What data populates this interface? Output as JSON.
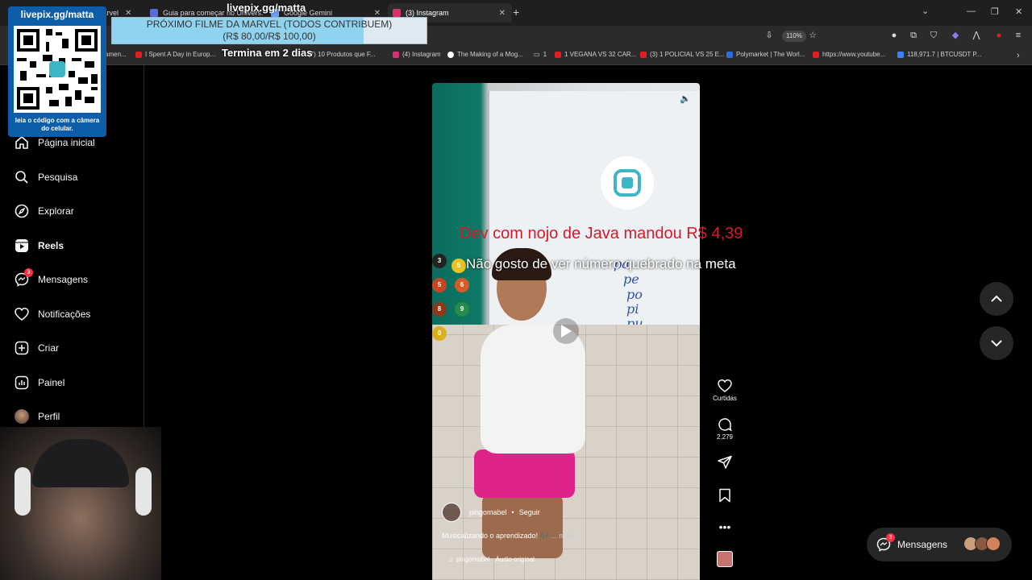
{
  "tabs": [
    {
      "label": "Marvel",
      "favicon_color": "#4a90d9"
    },
    {
      "label": "Guia para começar no Univers...",
      "favicon_color": "#5b6bd6"
    },
    {
      "label": "Google Gemini",
      "favicon_color": "#6aa0ff"
    },
    {
      "label": "(3) Instagram",
      "favicon_color": "#d6306f",
      "active": true
    }
  ],
  "toolbar": {
    "zoom": "110%"
  },
  "bookmarks": [
    {
      "label": "amen...",
      "color": "#4a90d9"
    },
    {
      "label": "I Spent A Day in Europ...",
      "color": "#e02020"
    },
    {
      "label": "(7) 10 Produtos que F...",
      "color": "#e02020"
    },
    {
      "label": "(4) Instagram",
      "color": "#d6306f"
    },
    {
      "label": "The Making of a Mog...",
      "color": "#ffffff"
    },
    {
      "label": "1",
      "color": "#cccccc"
    },
    {
      "label": "1 VEGANA VS 32 CAR...",
      "color": "#e02020"
    },
    {
      "label": "(3) 1 POLICIAL VS 25 E...",
      "color": "#e02020"
    },
    {
      "label": "Polymarket | The Worl...",
      "color": "#2d6cdf"
    },
    {
      "label": "https://www.youtube...",
      "color": "#e02020"
    },
    {
      "label": "118,971.7 | BTCUSDT P...",
      "color": "#3b82f6"
    }
  ],
  "sidebar": {
    "items": [
      {
        "label": "Página inicial",
        "icon": "home-icon"
      },
      {
        "label": "Pesquisa",
        "icon": "search-icon"
      },
      {
        "label": "Explorar",
        "icon": "compass-icon"
      },
      {
        "label": "Reels",
        "icon": "reels-icon",
        "active": true
      },
      {
        "label": "Mensagens",
        "icon": "messenger-icon",
        "badge": "3"
      },
      {
        "label": "Notificações",
        "icon": "heart-icon"
      },
      {
        "label": "Criar",
        "icon": "plus-square-icon"
      },
      {
        "label": "Painel",
        "icon": "dashboard-icon"
      },
      {
        "label": "Perfil",
        "icon": "avatar"
      }
    ]
  },
  "reel": {
    "author": "pingomabel",
    "follow": "Seguir",
    "caption": "Musicalizando o aprendizado! 🎶",
    "caption_more": "... mais",
    "audio": "pingomabel · Áudio original",
    "board_text": [
      "pa",
      "pe",
      "po",
      "pi",
      "pu"
    ],
    "ball_numbers": [
      "3",
      "5",
      "6",
      "8",
      "9",
      "0",
      "4"
    ]
  },
  "actions": {
    "likes_label": "Curtidas",
    "comments_count": "2.279"
  },
  "messages_pill": {
    "label": "Mensagens",
    "badge": "3"
  },
  "stream_overlay": {
    "qr_title": "livepix.gg/matta",
    "qr_caption": "leia o código com a câmera do celular.",
    "goal_title": "livepix.gg/matta",
    "goal_line1": "PRÓXIMO FILME DA MARVEL (TODOS CONTRIBUEM)",
    "goal_line2": "(R$ 80,00/R$ 100,00)",
    "goal_progress": 0.8,
    "goal_timer": "Termina em 2 dias",
    "alert_title": "Dev com nojo de Java mandou R$ 4,39",
    "alert_message": "Não gosto de ver número quebrado na meta"
  },
  "colors": {
    "accent_badge": "#ff3040",
    "alert_red": "#d8182b",
    "qr_blue": "#0d5da8"
  }
}
